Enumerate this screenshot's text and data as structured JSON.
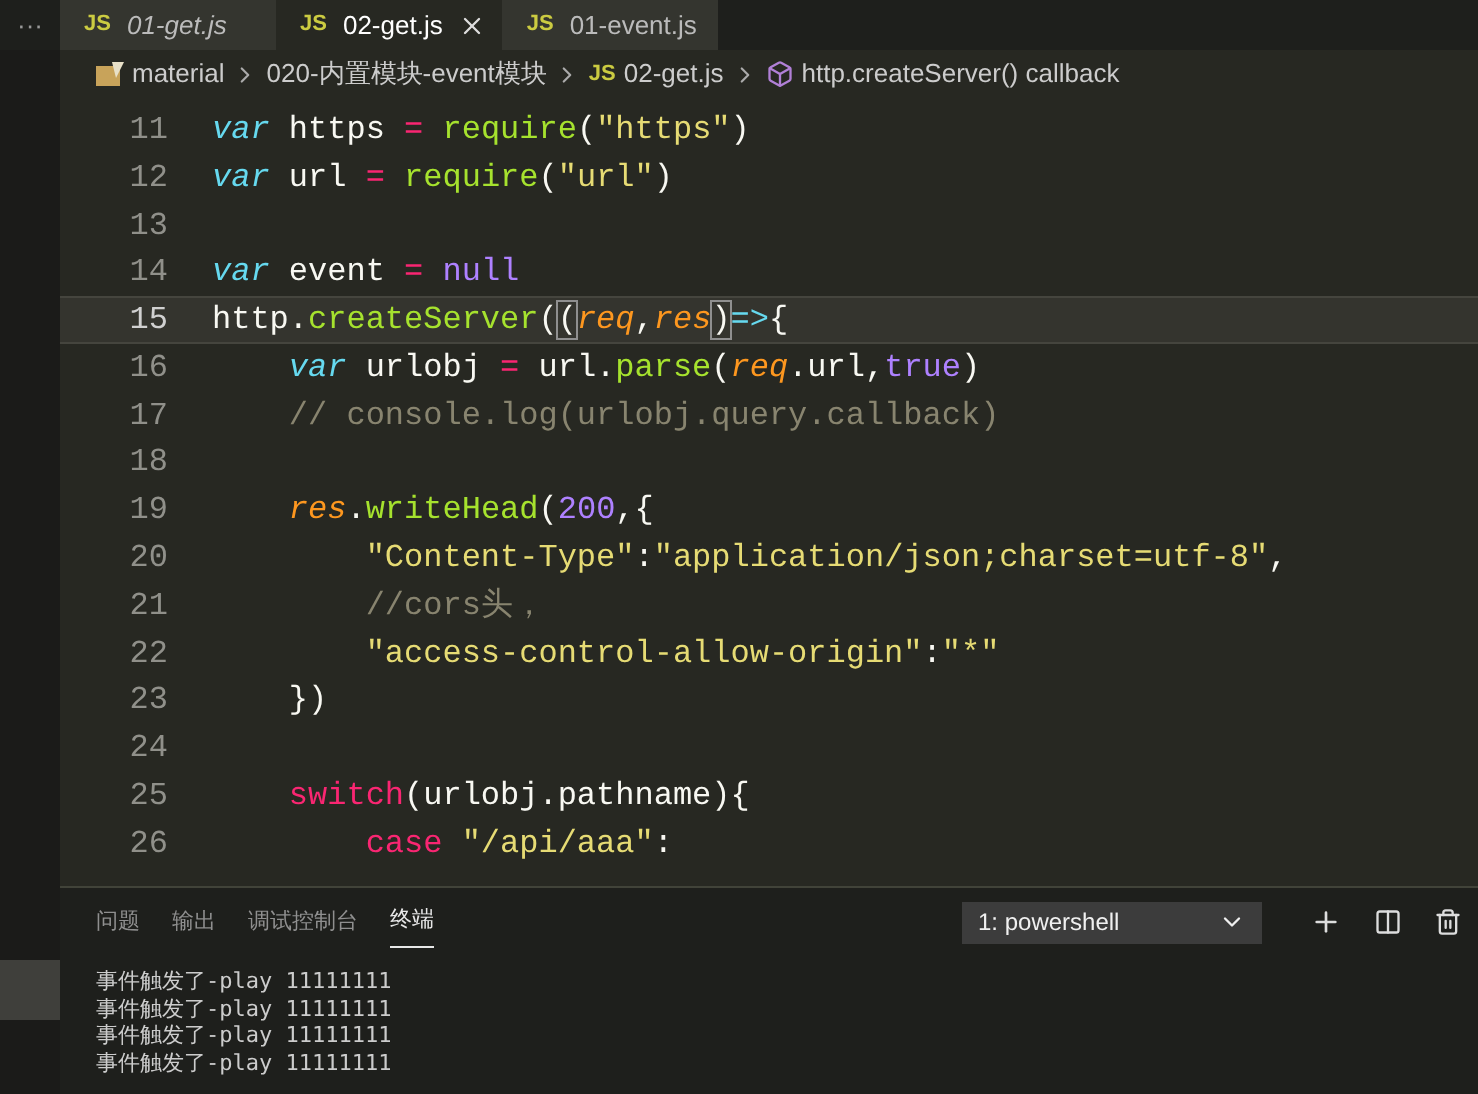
{
  "tabs": [
    {
      "icon": "JS",
      "label": "01-get.js",
      "selected": false,
      "preview": true,
      "closable": false
    },
    {
      "icon": "JS",
      "label": "02-get.js",
      "selected": true,
      "preview": false,
      "closable": true
    },
    {
      "icon": "JS",
      "label": "01-event.js",
      "selected": false,
      "preview": false,
      "closable": false
    }
  ],
  "tabs_overflow": "···",
  "breadcrumb": [
    {
      "kind": "folder",
      "text": "material"
    },
    {
      "kind": "folder",
      "text": "020-内置模块-event模块"
    },
    {
      "kind": "file",
      "icon": "JS",
      "text": "02-get.js"
    },
    {
      "kind": "symbol",
      "text": "http.createServer() callback"
    }
  ],
  "editor": {
    "lines": [
      {
        "number": "11",
        "current": false,
        "tokens": [
          {
            "kind": "keyword",
            "text": "var"
          },
          {
            "kind": "plain",
            "text": " https "
          },
          {
            "kind": "op",
            "text": "= "
          },
          {
            "kind": "func",
            "text": "require"
          },
          {
            "kind": "plain",
            "text": "("
          },
          {
            "kind": "string",
            "text": "\"https\""
          },
          {
            "kind": "plain",
            "text": ")"
          }
        ]
      },
      {
        "number": "12",
        "current": false,
        "tokens": [
          {
            "kind": "keyword",
            "text": "var"
          },
          {
            "kind": "plain",
            "text": " url "
          },
          {
            "kind": "op",
            "text": "= "
          },
          {
            "kind": "func",
            "text": "require"
          },
          {
            "kind": "plain",
            "text": "("
          },
          {
            "kind": "string",
            "text": "\"url\""
          },
          {
            "kind": "plain",
            "text": ")"
          }
        ]
      },
      {
        "number": "13",
        "current": false
      },
      {
        "number": "14",
        "current": false,
        "tokens": [
          {
            "kind": "keyword",
            "text": "var"
          },
          {
            "kind": "plain",
            "text": " event "
          },
          {
            "kind": "op",
            "text": "= "
          },
          {
            "kind": "const",
            "text": "null"
          }
        ]
      },
      {
        "number": "15",
        "current": true,
        "tokens": [
          {
            "kind": "plain",
            "text": "http."
          },
          {
            "kind": "func",
            "text": "createServer"
          },
          {
            "kind": "plain",
            "text": "("
          },
          {
            "kind": "bracket",
            "text": "("
          },
          {
            "kind": "param",
            "text": "req"
          },
          {
            "kind": "plain",
            "text": ","
          },
          {
            "kind": "param",
            "text": "res"
          },
          {
            "kind": "bracket",
            "text": ")"
          },
          {
            "kind": "keyword_plain",
            "text": "=>"
          },
          {
            "kind": "plain",
            "text": "{"
          }
        ]
      },
      {
        "number": "16",
        "current": false,
        "tokens": [
          {
            "kind": "keyword",
            "text": "    var"
          },
          {
            "kind": "plain",
            "text": " urlobj "
          },
          {
            "kind": "op",
            "text": "= "
          },
          {
            "kind": "plain",
            "text": "url."
          },
          {
            "kind": "func",
            "text": "parse"
          },
          {
            "kind": "plain",
            "text": "("
          },
          {
            "kind": "param",
            "text": "req"
          },
          {
            "kind": "plain",
            "text": ".url,"
          },
          {
            "kind": "const",
            "text": "true"
          },
          {
            "kind": "plain",
            "text": ")"
          }
        ]
      },
      {
        "number": "17",
        "current": false,
        "tokens": [
          {
            "kind": "comment",
            "text": "    // console.log(urlobj.query.callback)"
          }
        ]
      },
      {
        "number": "18",
        "current": false
      },
      {
        "number": "19",
        "current": false,
        "tokens": [
          {
            "kind": "param",
            "text": "    res"
          },
          {
            "kind": "plain",
            "text": "."
          },
          {
            "kind": "func",
            "text": "writeHead"
          },
          {
            "kind": "plain",
            "text": "("
          },
          {
            "kind": "const",
            "text": "200"
          },
          {
            "kind": "plain",
            "text": ",{"
          }
        ]
      },
      {
        "number": "20",
        "current": false,
        "tokens": [
          {
            "kind": "string",
            "text": "        \"Content-Type\""
          },
          {
            "kind": "plain",
            "text": ":"
          },
          {
            "kind": "string",
            "text": "\"application/json;charset=utf-8\""
          },
          {
            "kind": "plain",
            "text": ","
          }
        ]
      },
      {
        "number": "21",
        "current": false,
        "tokens": [
          {
            "kind": "comment",
            "text": "        //cors头，"
          }
        ]
      },
      {
        "number": "22",
        "current": false,
        "tokens": [
          {
            "kind": "string",
            "text": "        \"access-control-allow-origin\""
          },
          {
            "kind": "plain",
            "text": ":"
          },
          {
            "kind": "string",
            "text": "\"*\""
          }
        ]
      },
      {
        "number": "23",
        "current": false,
        "tokens": [
          {
            "kind": "plain",
            "text": "    })"
          }
        ]
      },
      {
        "number": "24",
        "current": false
      },
      {
        "number": "25",
        "current": false,
        "tokens": [
          {
            "kind": "control",
            "text": "    switch"
          },
          {
            "kind": "plain",
            "text": "(urlobj.pathname){"
          }
        ]
      },
      {
        "number": "26",
        "current": false,
        "tokens": [
          {
            "kind": "control",
            "text": "        case"
          },
          {
            "kind": "string",
            "text": " \"/api/aaa\""
          },
          {
            "kind": "plain",
            "text": ":"
          }
        ]
      }
    ]
  },
  "panel": {
    "tabs": [
      {
        "label": "问题",
        "selected": false
      },
      {
        "label": "输出",
        "selected": false
      },
      {
        "label": "调试控制台",
        "selected": false
      },
      {
        "label": "终端",
        "selected": true
      }
    ],
    "terminal_select": "1: powershell",
    "terminal_lines": [
      "事件触发了-play 11111111",
      "事件触发了-play 11111111",
      "事件触发了-play 11111111",
      "事件触发了-play 11111111"
    ]
  }
}
